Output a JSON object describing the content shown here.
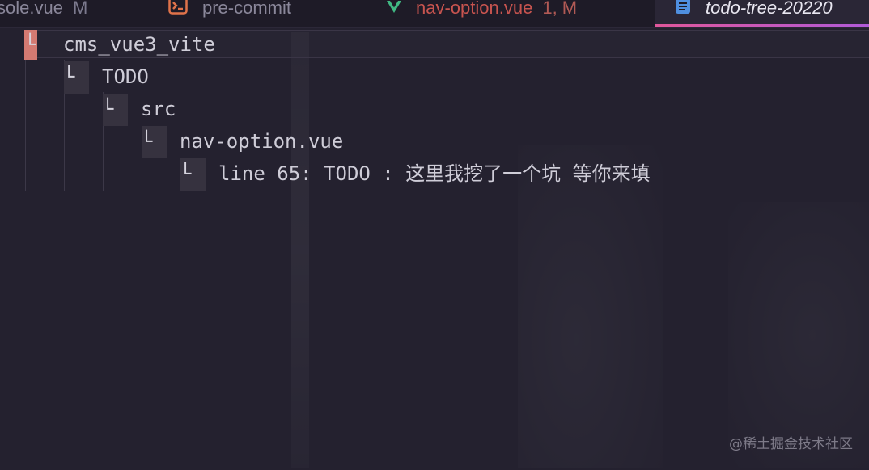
{
  "tabs": [
    {
      "label": "sole.vue",
      "modifier": "M",
      "icon": "vue-file-icon"
    },
    {
      "label": "pre-commit",
      "icon": "terminal-icon"
    },
    {
      "label": "nav-option.vue",
      "modifier": "1, M",
      "icon": "vue-icon"
    },
    {
      "label": "todo-tree-20220",
      "icon": "document-icon"
    }
  ],
  "tree": {
    "root": "cms_vue3_vite",
    "category": "TODO",
    "folder": "src",
    "file": "nav-option.vue",
    "entry": "line 65: TODO : 这里我挖了一个坑 等你来填"
  },
  "branch_char": "└",
  "watermark": "@稀土掘金技术社区",
  "colors": {
    "background": "#24212f",
    "active_tab_accent": "#e0579b",
    "cursor": "#d47a72",
    "error_tab": "#c8544f"
  }
}
